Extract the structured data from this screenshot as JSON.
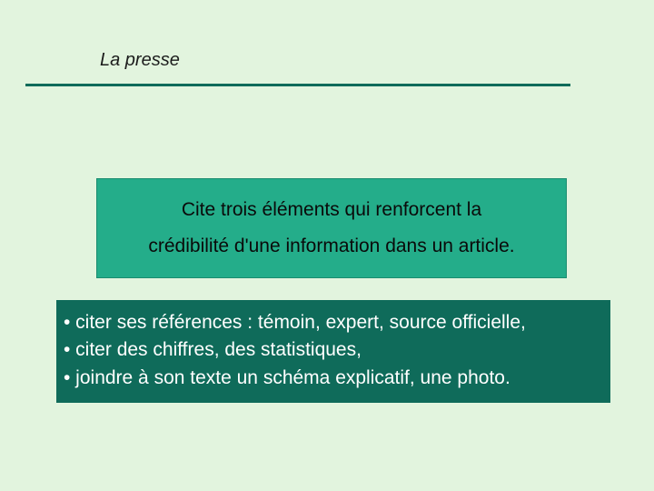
{
  "header": {
    "title": "La presse"
  },
  "question": {
    "line1": "Cite trois éléments qui renforcent la",
    "line2": "crédibilité d'une information dans un article."
  },
  "answers": {
    "a1": "• citer ses références : témoin, expert, source officielle,",
    "a2": "• citer des chiffres, des statistiques,",
    "a3": "• joindre à son texte un schéma explicatif, une photo."
  }
}
